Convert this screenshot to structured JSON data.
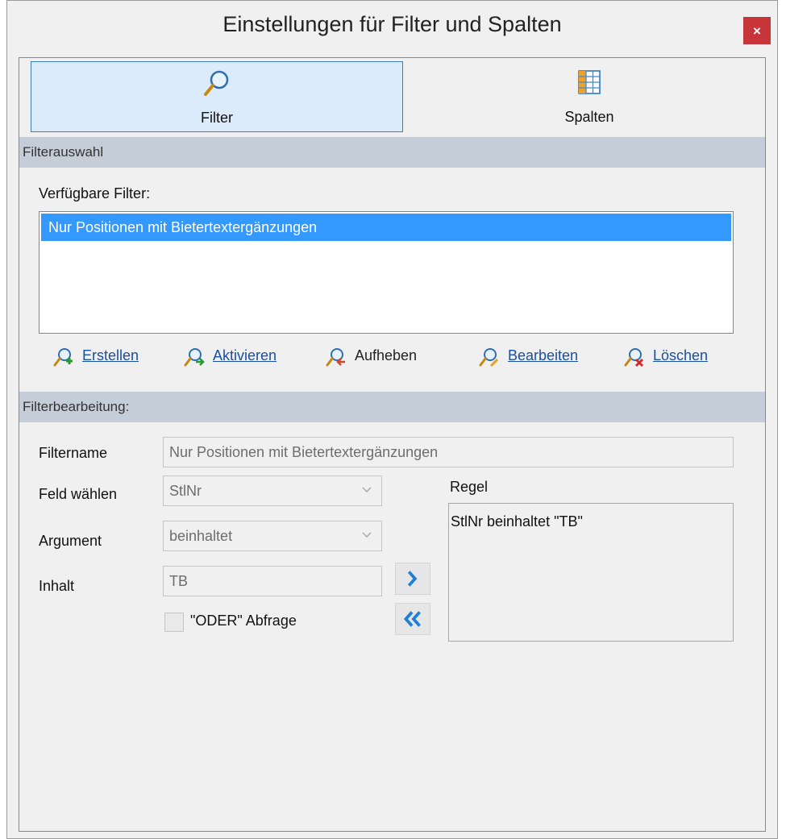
{
  "window": {
    "title": "Einstellungen für Filter und Spalten",
    "close_label": "×"
  },
  "tabs": [
    {
      "label": "Filter",
      "icon": "magnifier-icon",
      "active": true
    },
    {
      "label": "Spalten",
      "icon": "columns-grid-icon",
      "active": false
    }
  ],
  "filter_selection": {
    "header": "Filterauswahl",
    "available_label": "Verfügbare Filter:",
    "items": [
      "Nur Positionen mit Bietertextergänzungen"
    ],
    "selected_index": 0
  },
  "actions": [
    {
      "label": "Erstellen",
      "icon": "filter-add-icon",
      "enabled": true
    },
    {
      "label": "Aktivieren",
      "icon": "filter-activate-icon",
      "enabled": true
    },
    {
      "label": "Aufheben",
      "icon": "filter-remove-icon",
      "enabled": false
    },
    {
      "label": "Bearbeiten",
      "icon": "filter-edit-icon",
      "enabled": true
    },
    {
      "label": "Löschen",
      "icon": "filter-delete-icon",
      "enabled": true
    }
  ],
  "filter_edit": {
    "header": "Filterbearbeitung:",
    "name_label": "Filtername",
    "name_value": "Nur Positionen mit Bietertextergänzungen",
    "field_label": "Feld wählen",
    "field_value": "StlNr",
    "argument_label": "Argument",
    "argument_value": "beinhaltet",
    "content_label": "Inhalt",
    "content_value": "TB",
    "or_query_label": "\"ODER\" Abfrage",
    "or_query_checked": false,
    "rule_label": "Regel",
    "rules": [
      "StlNr beinhaltet \"TB\""
    ]
  },
  "colors": {
    "accent": "#3399ff",
    "tab_active_bg": "#dcebfc",
    "section_header_bg": "#c5ced8",
    "close_red": "#c7353a",
    "link": "#1a4fa1"
  }
}
